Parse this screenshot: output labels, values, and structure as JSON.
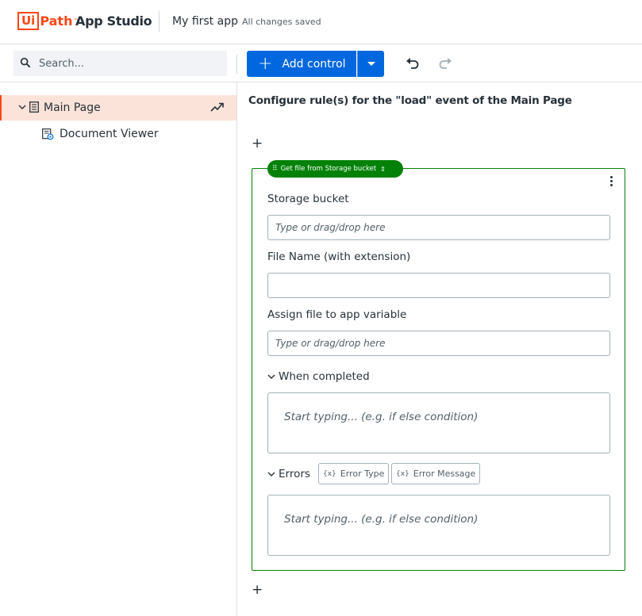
{
  "header": {
    "logo_ui": "Ui",
    "logo_path": "Path",
    "app_name": "App Studio",
    "project_name": "My first app",
    "save_status": "All changes saved"
  },
  "toolbar": {
    "search_placeholder": "Search...",
    "add_control_label": "Add control"
  },
  "sidebar": {
    "items": [
      {
        "label": "Main Page",
        "icon": "page-icon",
        "expanded": true,
        "selected": true
      },
      {
        "label": "Document Viewer",
        "icon": "document-viewer-icon"
      }
    ]
  },
  "main": {
    "title": "Configure rule(s) for the \"load\" event of the Main Page",
    "add_symbol": "+",
    "rule": {
      "name": "Get file from Storage bucket",
      "fields": [
        {
          "label": "Storage bucket",
          "value": "",
          "placeholder": "Type or drag/drop here"
        },
        {
          "label": "File Name (with extension)",
          "value": "",
          "placeholder": ""
        },
        {
          "label": "Assign file to app variable",
          "value": "",
          "placeholder": "Type or drag/drop here"
        }
      ],
      "when_completed": {
        "label": "When completed",
        "placeholder": "Start typing... (e.g. if else condition)"
      },
      "errors": {
        "label": "Errors",
        "chips": [
          "Error Type",
          "Error Message"
        ],
        "chip_icon_text": "{x}",
        "placeholder": "Start typing... (e.g. if else condition)"
      }
    }
  },
  "colors": {
    "brand": "#fa4616",
    "primary": "#0067df",
    "rule_green": "#038108",
    "selected_bg": "#fbe3d9"
  }
}
